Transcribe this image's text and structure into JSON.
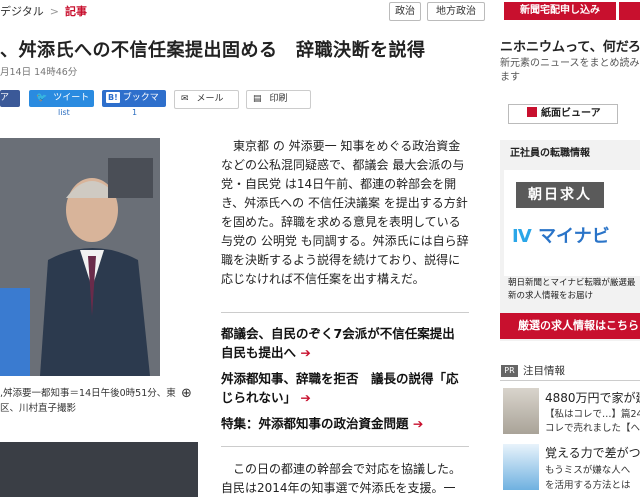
{
  "breadcrumb": {
    "site": "デジタル",
    "sep": ">",
    "current": "記事"
  },
  "tags": [
    "政治",
    "地方政治"
  ],
  "header_button": "新聞宅配申し込み",
  "headline": "、舛添氏への不信任案提出固める　辞職決断を説得",
  "date": "月14日 14時46分",
  "share": {
    "twitter": "ツイート",
    "twitter_count": "list",
    "bookmark_prefix": "B!",
    "bookmark": "ブックマーク",
    "bookmark_count": "1",
    "mail": "メール",
    "print": "印刷",
    "facebook": "ア"
  },
  "photo_caption": ",舛添要一都知事＝14日午後0時51分、東\n区、川村直子撮影",
  "article": {
    "p1": "東京都 の 舛添要一 知事をめぐる政治資金などの公私混同疑惑で、都議会 最大会派の与党・自民党 は14日午前、都連の幹部会を開き、舛添氏への 不信任決議案 を提出する方針を固めた。辞職を求める意見を表明している与党の 公明党 も同調する。舛添氏には自ら辞職を決断するよう説得を続けており、説得に応じなければ不信任案を出す構えだ。",
    "p2": "この日の都連の幹部会で対応を協議した。自民は2014年の知事選で舛添氏を支援。一"
  },
  "related": [
    {
      "title": "都議会、自民のぞく7会派が不信任案提出　自民も提出へ"
    },
    {
      "title": "舛添都知事、辞職を拒否　議長の説得「応じられない」"
    },
    {
      "title": "特集：舛添都知事の政治資金問題"
    }
  ],
  "sidebar": {
    "title": "ニホニウムって、何だろう",
    "subtitle": "新元素のニュースをまとめ読みます",
    "paper_button": "紙面ビューア",
    "ad_label": "正社員の転職情報",
    "ad_asahi": "朝日求人",
    "ad_navi": "マイナビ",
    "ad_desc": "朝日新聞とマイナビ転職が厳選最新の求人情報をお届け",
    "ad_red": "厳選の求人情報はこちら",
    "pr_badge": "PR",
    "pr_title": "注目情報",
    "pr1": {
      "l1": "4880万円で家が建つ",
      "l2": "【私はコレで…】篇24",
      "l3": "コレで売れました【ヘ"
    },
    "pr2": {
      "l1": "覚える力で差がつく",
      "l2": "もうミスが嫌な人へ",
      "l3": "を活用する方法とは"
    }
  }
}
